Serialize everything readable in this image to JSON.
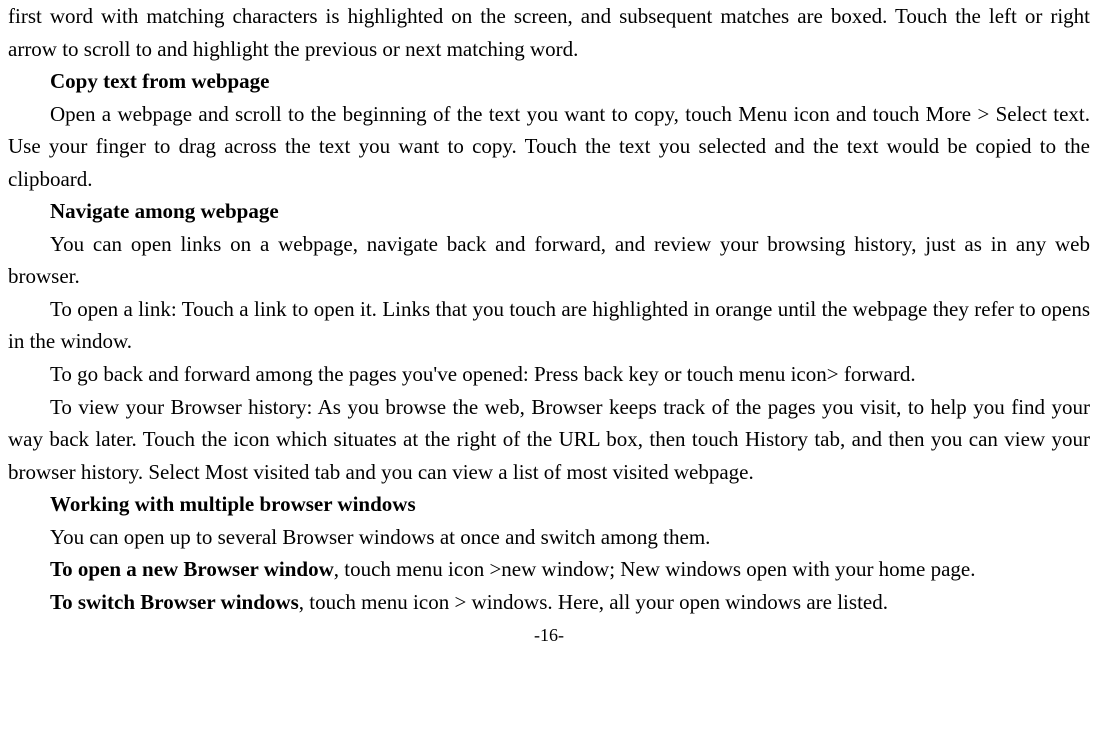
{
  "p1": "first word with matching characters is highlighted on the screen, and subsequent matches are boxed. Touch the left or right arrow to scroll to and highlight the previous or next matching word.",
  "h1": "Copy text from webpage",
  "p2": "Open a webpage and scroll to the beginning of the text you want to copy, touch Menu icon and touch More > Select text. Use your finger to drag across the text you want to copy. Touch the text you selected and the text would be copied to the clipboard.",
  "h2": "Navigate among webpage",
  "p3": "You can open links on a webpage, navigate back and forward, and review your browsing history, just as in any web browser.",
  "p4": "To open a link: Touch a link to open it. Links that you touch are highlighted in orange until the webpage they refer to opens in the window.",
  "p5": "To go back and forward among the pages you've opened: Press back key or touch menu icon> forward.",
  "p6": "To view your Browser history: As you browse the web, Browser keeps track of the pages you visit, to help you find your way back later. Touch the icon which situates at the right of the URL box, then touch History tab, and then you can view your browser history. Select Most visited tab and you can view a list of most visited webpage.",
  "h3": "Working with multiple browser windows",
  "p7": "You can open up to several Browser windows at once and switch among them.",
  "p8a": "To open a new Browser window",
  "p8b": ", touch menu icon >new window; New windows open with your home page.",
  "p9a": "To switch Browser windows",
  "p9b": ", touch menu icon > windows. Here, all your open windows are listed.",
  "footer": "-16-"
}
